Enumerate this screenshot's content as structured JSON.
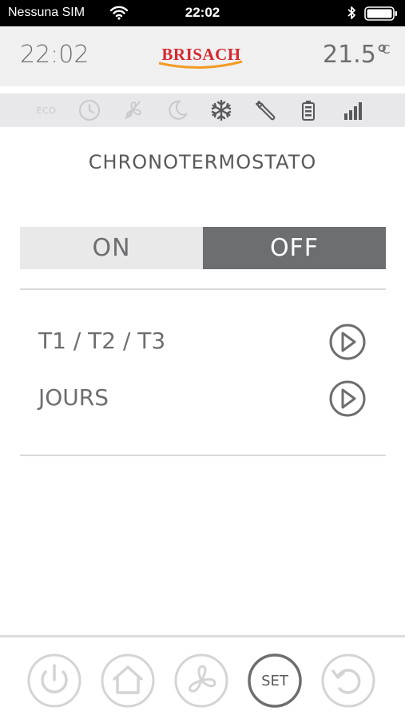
{
  "statusbar": {
    "carrier": "Nessuna SIM",
    "time": "22:02",
    "icons": [
      "wifi-icon",
      "bluetooth-icon",
      "battery-icon"
    ]
  },
  "header": {
    "time": "22:02",
    "logo_text": "BRISACH",
    "temperature": "21.5°",
    "unit": "C"
  },
  "status_icons": {
    "eco_label": "ECO",
    "icons": [
      "clock-icon",
      "fan-off-icon",
      "moon-icon",
      "snowflake-icon",
      "wrench-icon",
      "battery-level-icon",
      "signal-bars-icon"
    ],
    "active": [
      "snowflake-icon",
      "wrench-icon",
      "battery-level-icon",
      "signal-bars-icon"
    ]
  },
  "page": {
    "title": "CHRONOTERMOSTATO"
  },
  "toggle": {
    "on_label": "ON",
    "off_label": "OFF",
    "selected": "OFF"
  },
  "menu": {
    "items": [
      {
        "label": "T1 / T2 / T3",
        "action_icon": "play-circle-icon"
      },
      {
        "label": "JOURS",
        "action_icon": "play-circle-icon"
      }
    ]
  },
  "bottom_nav": {
    "items": [
      {
        "icon": "power-icon"
      },
      {
        "icon": "home-icon"
      },
      {
        "icon": "fan-icon"
      },
      {
        "icon": "set-icon",
        "label": "SET"
      },
      {
        "icon": "undo-icon"
      }
    ],
    "active": "set-icon"
  },
  "colors": {
    "text_gray": "#6d6e70",
    "header_bg": "#f0f0f1",
    "iconrow_bg": "#e8e8ea",
    "toggle_active_bg": "#6d6e70",
    "logo_red": "#d7282f",
    "logo_orange": "#f29a22"
  }
}
